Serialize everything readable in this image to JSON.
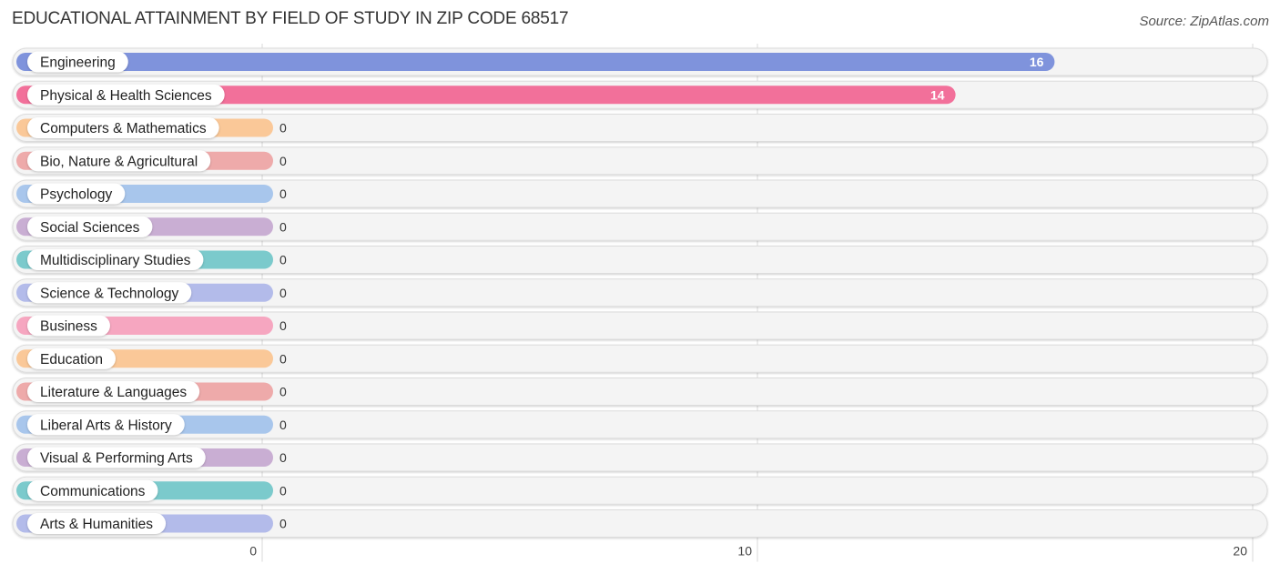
{
  "header": {
    "title": "EDUCATIONAL ATTAINMENT BY FIELD OF STUDY IN ZIP CODE 68517",
    "source": "Source: ZipAtlas.com"
  },
  "chart_data": {
    "type": "bar",
    "orientation": "horizontal",
    "title": "EDUCATIONAL ATTAINMENT BY FIELD OF STUDY IN ZIP CODE 68517",
    "xlabel": "",
    "ylabel": "",
    "xlim": [
      0,
      20
    ],
    "xticks": [
      0,
      10,
      20
    ],
    "grid": true,
    "categories": [
      "Engineering",
      "Physical & Health Sciences",
      "Computers & Mathematics",
      "Bio, Nature & Agricultural",
      "Psychology",
      "Social Sciences",
      "Multidisciplinary Studies",
      "Science & Technology",
      "Business",
      "Education",
      "Literature & Languages",
      "Liberal Arts & History",
      "Visual & Performing Arts",
      "Communications",
      "Arts & Humanities"
    ],
    "values": [
      16,
      14,
      0,
      0,
      0,
      0,
      0,
      0,
      0,
      0,
      0,
      0,
      0,
      0,
      0
    ],
    "colors": [
      "#7f93dc",
      "#f2709a",
      "#fac898",
      "#eeaaaa",
      "#a8c6ec",
      "#c9aed3",
      "#7bcacc",
      "#b3bbea",
      "#f6a6c0",
      "#fac898",
      "#eeaaaa",
      "#a8c6ec",
      "#c9aed3",
      "#7bcacc",
      "#b3bbea"
    ]
  }
}
